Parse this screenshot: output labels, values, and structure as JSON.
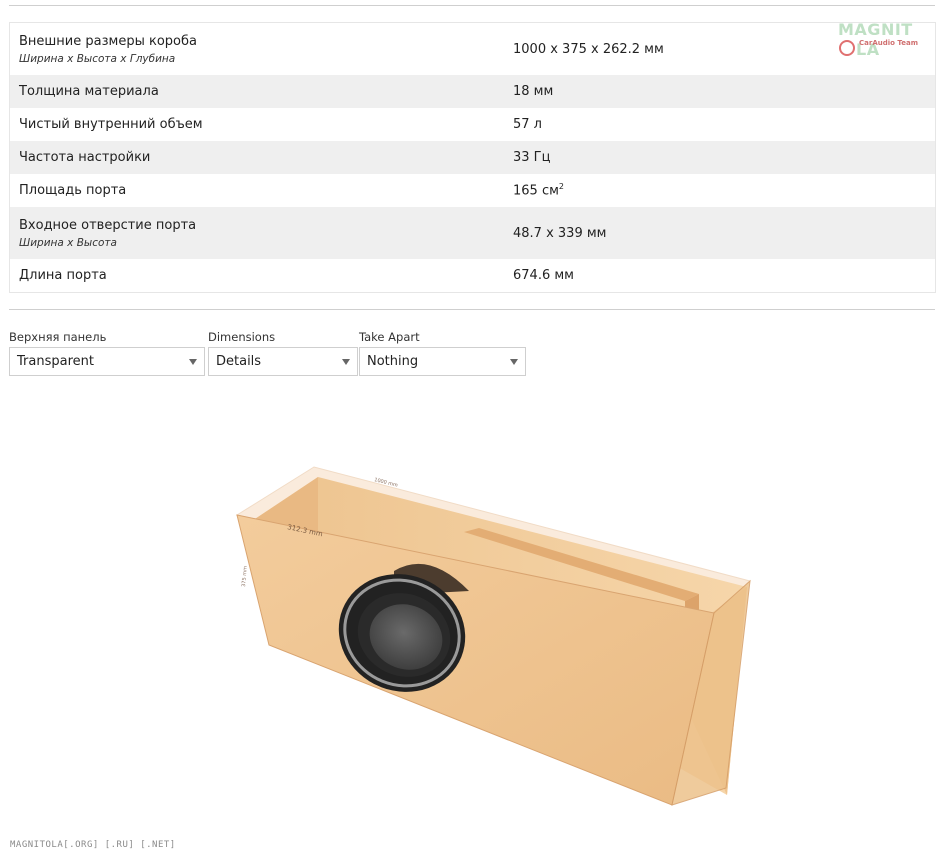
{
  "logo": {
    "main": "MAGNIT",
    "tail": "LA",
    "sub": "CarAudio Team"
  },
  "specs": [
    {
      "label": "Внешние размеры короба",
      "sublabel": "Ширина x Высота x Глубина",
      "value": "1000 x 375 x 262.2 мм"
    },
    {
      "label": "Толщина материала",
      "sublabel": "",
      "value": "18 мм"
    },
    {
      "label": "Чистый внутренний объем",
      "sublabel": "",
      "value": "57 л"
    },
    {
      "label": "Частота настройки",
      "sublabel": "",
      "value": "33 Гц"
    },
    {
      "label": "Площадь порта",
      "sublabel": "",
      "value": "165 см",
      "value_sup": "2"
    },
    {
      "label": "Входное отверстие порта",
      "sublabel": "Ширина x Высота",
      "value": "48.7 x 339 мм"
    },
    {
      "label": "Длина порта",
      "sublabel": "",
      "value": "674.6 мм"
    }
  ],
  "controls": {
    "top_panel": {
      "label": "Верхняя панель",
      "value": "Transparent"
    },
    "dimensions": {
      "label": "Dimensions",
      "value": "Details"
    },
    "take_apart": {
      "label": "Take Apart",
      "value": "Nothing"
    }
  },
  "model_labels": {
    "width": "1000 mm",
    "depth": "312.3 mm",
    "height": "375 mm"
  },
  "colors": {
    "wood": "#f2c896",
    "wood_dark": "#e0ab73",
    "edge": "#d8a06a",
    "speaker": "#2d2d2d"
  },
  "footer": "MAGNITOLA[.ORG] [.RU] [.NET]"
}
